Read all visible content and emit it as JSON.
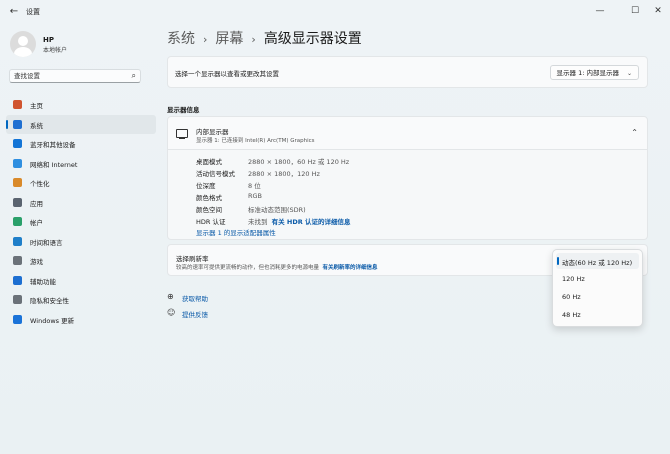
{
  "window": {
    "title": "设置",
    "controls": {
      "minimize": "—",
      "maximize": "☐",
      "close": "✕"
    }
  },
  "user": {
    "name": "HP",
    "account_type": "本地帐户"
  },
  "search": {
    "placeholder": "查找设置",
    "icon": "search-icon"
  },
  "sidebar": {
    "items": [
      {
        "label": "主页",
        "icon": "home-icon",
        "color": "#d0542f"
      },
      {
        "label": "系统",
        "icon": "system-icon",
        "color": "#1f6fd1",
        "active": true
      },
      {
        "label": "蓝牙和其他设备",
        "icon": "bluetooth-icon",
        "color": "#1475d6"
      },
      {
        "label": "网络和 Internet",
        "icon": "wifi-icon",
        "color": "#2f8fe0"
      },
      {
        "label": "个性化",
        "icon": "brush-icon",
        "color": "#d98a2a"
      },
      {
        "label": "应用",
        "icon": "apps-icon",
        "color": "#5a6470"
      },
      {
        "label": "帐户",
        "icon": "account-icon",
        "color": "#2aa06a"
      },
      {
        "label": "时间和语言",
        "icon": "globe-icon",
        "color": "#1f7fc9"
      },
      {
        "label": "游戏",
        "icon": "game-icon",
        "color": "#6b7279"
      },
      {
        "label": "辅助功能",
        "icon": "accessibility-icon",
        "color": "#1d6fd1"
      },
      {
        "label": "隐私和安全性",
        "icon": "shield-icon",
        "color": "#6b7279"
      },
      {
        "label": "Windows 更新",
        "icon": "update-icon",
        "color": "#1a73d8"
      }
    ]
  },
  "breadcrumb": {
    "items": [
      "系统",
      "屏幕",
      "高级显示器设置"
    ],
    "separator": "›"
  },
  "display_select": {
    "label": "选择一个显示器以查看或更改其设置",
    "value": "显示器 1: 内部显示器"
  },
  "display_info": {
    "section_title": "显示器信息",
    "header_title": "内部显示器",
    "header_subtitle": "显示器 1: 已连接到 Intel(R) Arc(TM) Graphics",
    "rows": [
      {
        "label": "桌面模式",
        "value": "2880 × 1800，60 Hz 或 120 Hz"
      },
      {
        "label": "活动信号模式",
        "value": "2880 × 1800，120 Hz"
      },
      {
        "label": "位深度",
        "value": "8 位"
      },
      {
        "label": "颜色格式",
        "value": "RGB"
      },
      {
        "label": "颜色空间",
        "value": "标准动态范围(SDR)"
      }
    ],
    "hdr": {
      "label": "HDR 认证",
      "value": "未找到",
      "link": "有关 HDR 认证的详细信息"
    },
    "adapter_link": "显示器 1 的显示适配器属性"
  },
  "refresh_rate": {
    "title": "选择刷新率",
    "description": "较高的速率可提供更流畅的动作，但也消耗更多的电源电量",
    "link": "有关刷新率的详细信息",
    "options": [
      "动态(60 Hz 或 120 Hz)",
      "120 Hz",
      "60 Hz",
      "48 Hz"
    ],
    "selected": "动态(60 Hz 或 120 Hz)"
  },
  "help": {
    "get_help": "获取帮助",
    "feedback": "提供反馈"
  },
  "colors": {
    "accent": "#0067c0",
    "link": "#0a5aa8"
  }
}
